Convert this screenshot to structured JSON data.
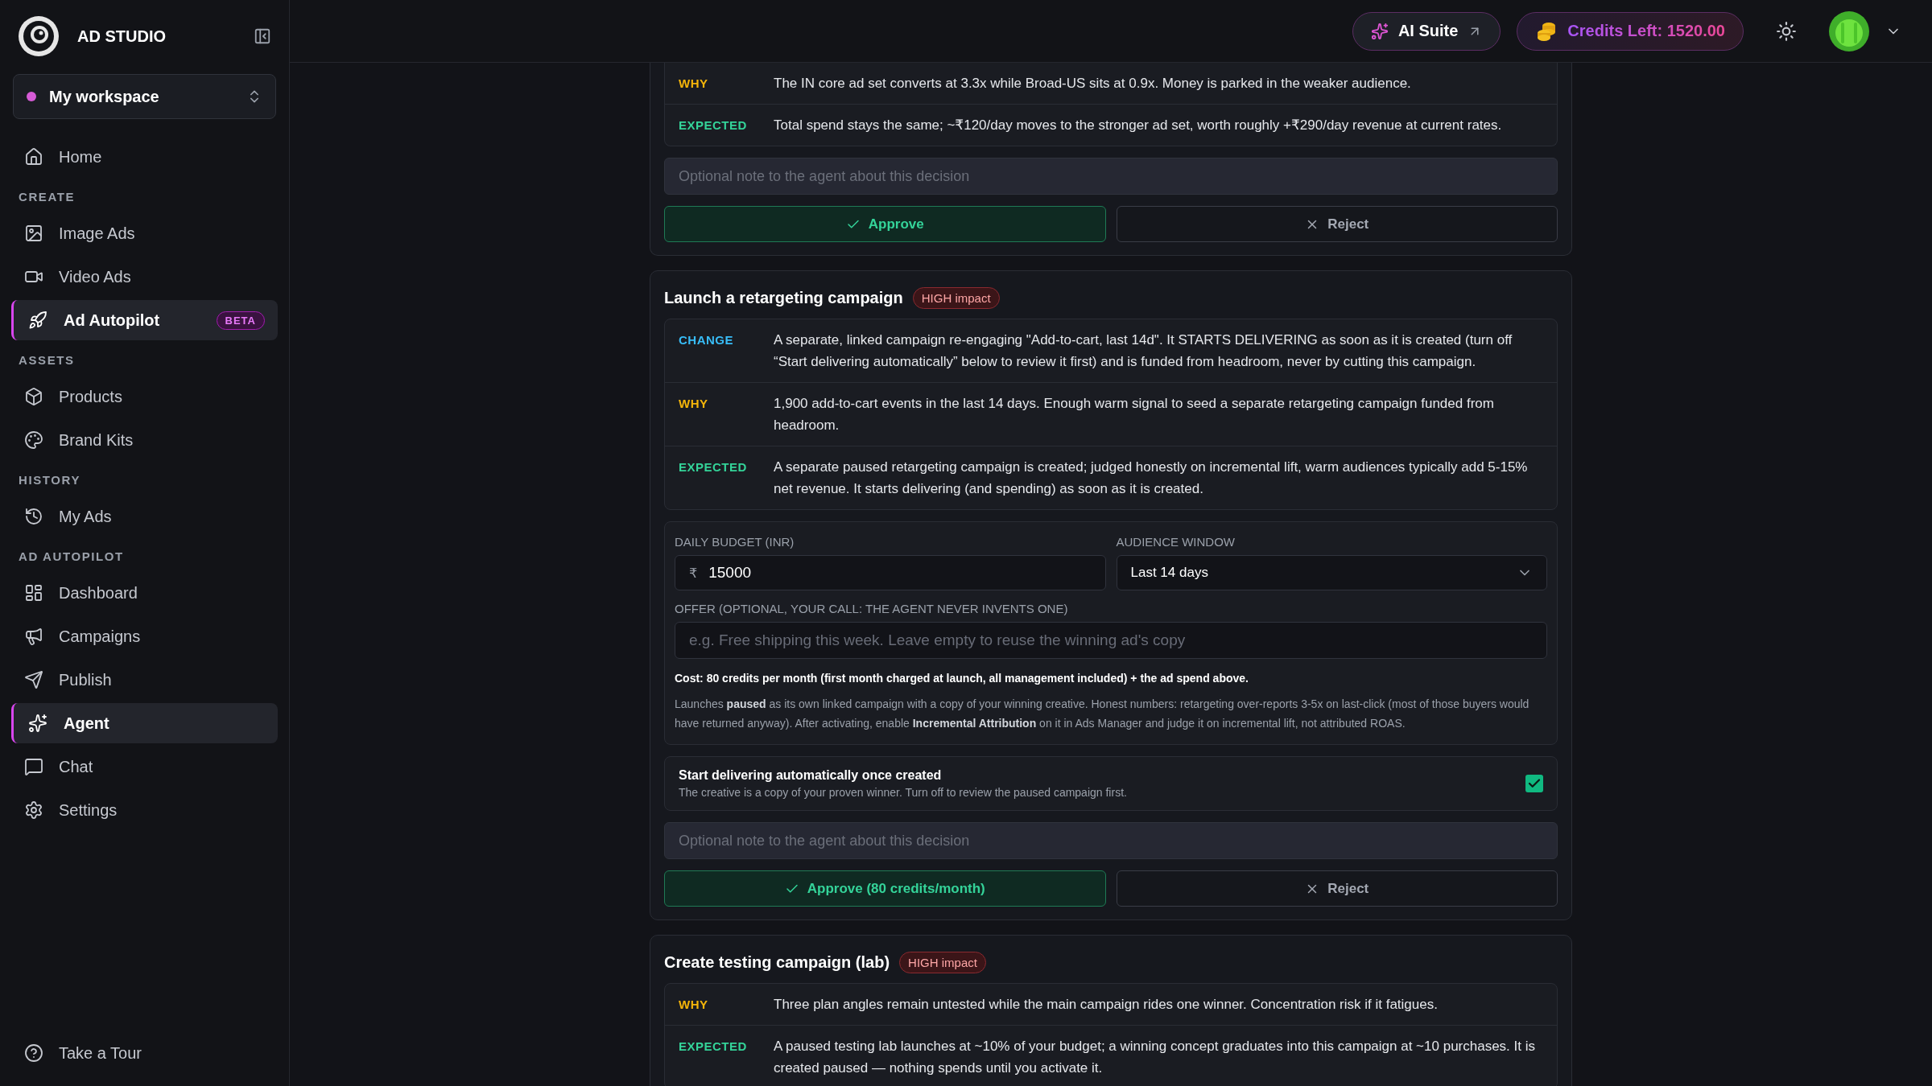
{
  "brand": {
    "name": "AD STUDIO"
  },
  "workspace": {
    "name": "My workspace"
  },
  "sidebar": {
    "groups": [
      {
        "items": [
          {
            "label": "Home",
            "selected": false
          }
        ]
      },
      {
        "title": "CREATE",
        "items": [
          {
            "label": "Image Ads",
            "selected": false
          },
          {
            "label": "Video Ads",
            "selected": false
          },
          {
            "label": "Ad Autopilot",
            "selected": true,
            "badge": "BETA"
          }
        ]
      },
      {
        "title": "ASSETS",
        "items": [
          {
            "label": "Products",
            "selected": false
          },
          {
            "label": "Brand Kits",
            "selected": false
          }
        ]
      },
      {
        "title": "HISTORY",
        "items": [
          {
            "label": "My Ads",
            "selected": false
          }
        ]
      },
      {
        "title": "AD AUTOPILOT",
        "items": [
          {
            "label": "Dashboard",
            "selected": false
          },
          {
            "label": "Campaigns",
            "selected": false
          },
          {
            "label": "Publish",
            "selected": false
          },
          {
            "label": "Agent",
            "selected": true
          },
          {
            "label": "Chat",
            "selected": false
          },
          {
            "label": "Settings",
            "selected": false
          }
        ]
      }
    ],
    "footer": {
      "label": "Take a Tour"
    }
  },
  "topbar": {
    "ai_suite": "AI Suite",
    "credits": "Credits Left: 1520.00"
  },
  "decisions": [
    {
      "rows": [
        {
          "kind": "why",
          "label": "WHY",
          "text": "The IN core ad set converts at 3.3x while Broad-US sits at 0.9x. Money is parked in the weaker audience."
        },
        {
          "kind": "expected",
          "label": "EXPECTED",
          "text": "Total spend stays the same; ~₹120/day moves to the stronger ad set, worth roughly +₹290/day revenue at current rates."
        }
      ],
      "note_placeholder": "Optional note to the agent about this decision",
      "approve": "Approve",
      "reject": "Reject"
    },
    {
      "title": "Launch a retargeting campaign",
      "impact": "HIGH impact",
      "rows": [
        {
          "kind": "change",
          "label": "CHANGE",
          "text": "A separate, linked campaign re-engaging \"Add-to-cart, last 14d\". It STARTS DELIVERING as soon as it is created (turn off “Start delivering automatically” below to review it first) and is funded from headroom, never by cutting this campaign."
        },
        {
          "kind": "why",
          "label": "WHY",
          "text": "1,900 add-to-cart events in the last 14 days. Enough warm signal to seed a separate retargeting campaign funded from headroom."
        },
        {
          "kind": "expected",
          "label": "EXPECTED",
          "text": "A separate paused retargeting campaign is created; judged honestly on incremental lift, warm audiences typically add 5-15% net revenue. It starts delivering (and spending) as soon as it is created."
        }
      ],
      "form": {
        "budget": {
          "label": "DAILY BUDGET (INR)",
          "prefix": "₹",
          "value": "15000"
        },
        "audience": {
          "label": "AUDIENCE WINDOW",
          "value": "Last 14 days"
        },
        "offer": {
          "label": "OFFER (OPTIONAL, YOUR CALL: THE AGENT NEVER INVENTS ONE)",
          "placeholder": "e.g. Free shipping this week. Leave empty to reuse the winning ad's copy"
        },
        "cost": "Cost: 80 credits per month (first month charged at launch, all management included) + the ad spend above.",
        "note": "Launches **paused** as its own linked campaign with a copy of your winning creative. Honest numbers: retargeting over-reports 3-5x on last-click (most of those buyers would have returned anyway). After activating, enable **Incremental Attribution** on it in Ads Manager and judge it on incremental lift, not attributed ROAS."
      },
      "toggle": {
        "title": "Start delivering automatically once created",
        "description": "The creative is a copy of your proven winner. Turn off to review the paused campaign first.",
        "checked": true
      },
      "note_placeholder": "Optional note to the agent about this decision",
      "approve": "Approve (80 credits/month)",
      "reject": "Reject"
    },
    {
      "title": "Create testing campaign (lab)",
      "impact": "HIGH impact",
      "rows": [
        {
          "kind": "why",
          "label": "WHY",
          "text": "Three plan angles remain untested while the main campaign rides one winner. Concentration risk if it fatigues."
        },
        {
          "kind": "expected",
          "label": "EXPECTED",
          "text": "A paused testing lab launches at ~10% of your budget; a winning concept graduates into this campaign at ~10 purchases. It is created paused — nothing spends until you activate it."
        }
      ]
    }
  ]
}
